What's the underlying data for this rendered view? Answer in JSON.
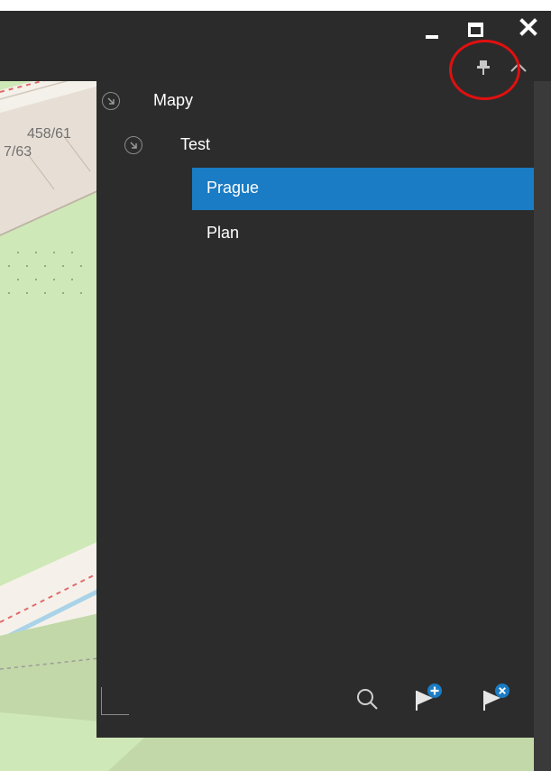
{
  "tree": {
    "items": [
      {
        "label": "Mapy"
      },
      {
        "label": "Test"
      },
      {
        "label": "Prague",
        "selected": true
      },
      {
        "label": "Plan"
      }
    ]
  },
  "map": {
    "labels": [
      "458/61",
      "7/63"
    ]
  },
  "colors": {
    "titlebar": "#2b2b2b",
    "panel": "#2c2c2c",
    "selection": "#1a7cc4",
    "annotation": "#e01010",
    "flag_badge": "#1a7cc4"
  },
  "icons": {
    "window": [
      "minimize-icon",
      "maximize-icon",
      "close-icon"
    ],
    "panel_header": [
      "pin-icon",
      "chevron-up-icon"
    ],
    "tree": [
      "expand-arrow-icon"
    ],
    "toolbar": [
      "search-icon",
      "flag-add-icon",
      "flag-remove-icon",
      "resize-grip-icon"
    ]
  }
}
